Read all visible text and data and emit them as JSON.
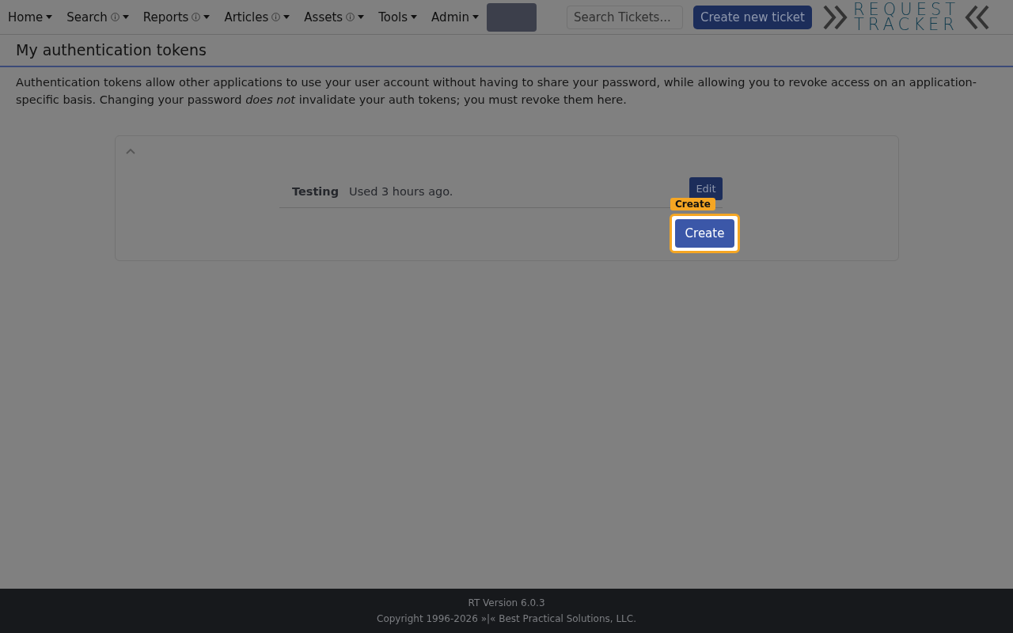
{
  "nav": {
    "items": [
      {
        "label": "Home",
        "info": false
      },
      {
        "label": "Search",
        "info": true
      },
      {
        "label": "Reports",
        "info": true
      },
      {
        "label": "Articles",
        "info": true
      },
      {
        "label": "Assets",
        "info": true
      },
      {
        "label": "Tools",
        "info": false
      },
      {
        "label": "Admin",
        "info": false
      }
    ],
    "search": {
      "placeholder": "Search Tickets..."
    },
    "create_ticket": "Create new ticket",
    "logo": {
      "line_1": "REQUEST",
      "line_2": "TRACKER"
    }
  },
  "page": {
    "title": "My authentication tokens",
    "description": "Authentication tokens allow other applications to use your user account without having to share your password, while allowing you to revoke access on an application-specific basis. Changing your password *does not* invalidate your auth tokens; you must revoke them here."
  },
  "panel": {
    "expanded": true,
    "tokens": [
      {
        "name": "Testing",
        "last_used": "Used 3 hours ago.",
        "action": "Edit"
      }
    ],
    "create_button": "Create"
  },
  "highlight": {
    "tag": "Create"
  },
  "footer": {
    "version": "RT Version 6.0.3",
    "copyright": "Copyright 1996-2026 »|« Best Practical Solutions, LLC."
  }
}
